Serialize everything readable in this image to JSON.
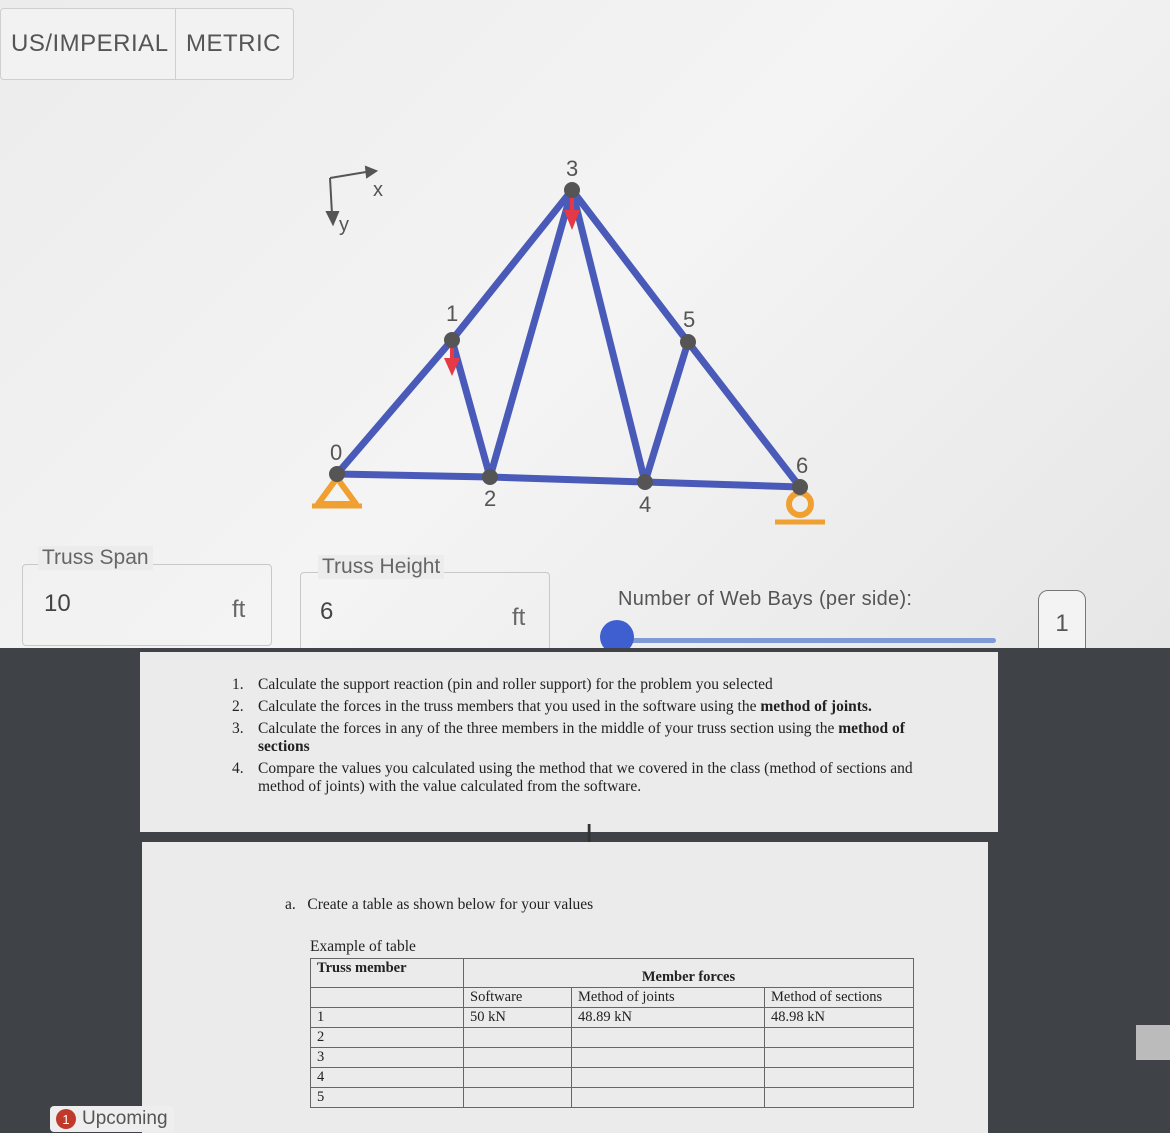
{
  "units": {
    "imperial": "US/IMPERIAL",
    "metric": "METRIC"
  },
  "axes": {
    "x": "x",
    "y": "y"
  },
  "nodes": [
    "0",
    "1",
    "2",
    "3",
    "4",
    "5",
    "6"
  ],
  "colors": {
    "members": "#4a5ab8",
    "supports": "#f0a030",
    "loads": "#e53945",
    "nodes": "#555555"
  },
  "inputs": {
    "span": {
      "label": "Truss Span",
      "value": "10",
      "unit": "ft"
    },
    "height": {
      "label": "Truss Height",
      "value": "6",
      "unit": "ft"
    },
    "bays": {
      "label": "Number of Web Bays (per side):",
      "value": "1"
    }
  },
  "assignment": {
    "steps": [
      {
        "num": "1.",
        "text": "Calculate the support reaction (pin and roller support) for the problem you selected"
      },
      {
        "num": "2.",
        "text_pre": "Calculate the forces in the truss members that you used in the software using the ",
        "text_bold": "method of joints."
      },
      {
        "num": "3.",
        "text_pre": "Calculate the forces in any of the three members in the middle of your truss section using the ",
        "text_bold": "method of sections"
      },
      {
        "num": "4.",
        "text": "Compare the values you calculated using the method that we covered in the class (method of sections and method of joints) with the value calculated from the software."
      }
    ],
    "create": {
      "marker": "a.",
      "text": "Create a table as shown below for your values"
    },
    "example_label": "Example of table",
    "table": {
      "col_member": "Truss member",
      "col_group": "Member forces",
      "col_software": "Software",
      "col_joints": "Method of joints",
      "col_sections": "Method of sections",
      "rows": [
        {
          "member": "1",
          "software": "50 kN",
          "joints": "48.89 kN",
          "sections": "48.98 kN"
        },
        {
          "member": "2",
          "software": "",
          "joints": "",
          "sections": ""
        },
        {
          "member": "3",
          "software": "",
          "joints": "",
          "sections": ""
        },
        {
          "member": "4",
          "software": "",
          "joints": "",
          "sections": ""
        },
        {
          "member": "5",
          "software": "",
          "joints": "",
          "sections": ""
        }
      ]
    }
  },
  "taskbar": {
    "badge": "1",
    "label": "Upcoming"
  }
}
